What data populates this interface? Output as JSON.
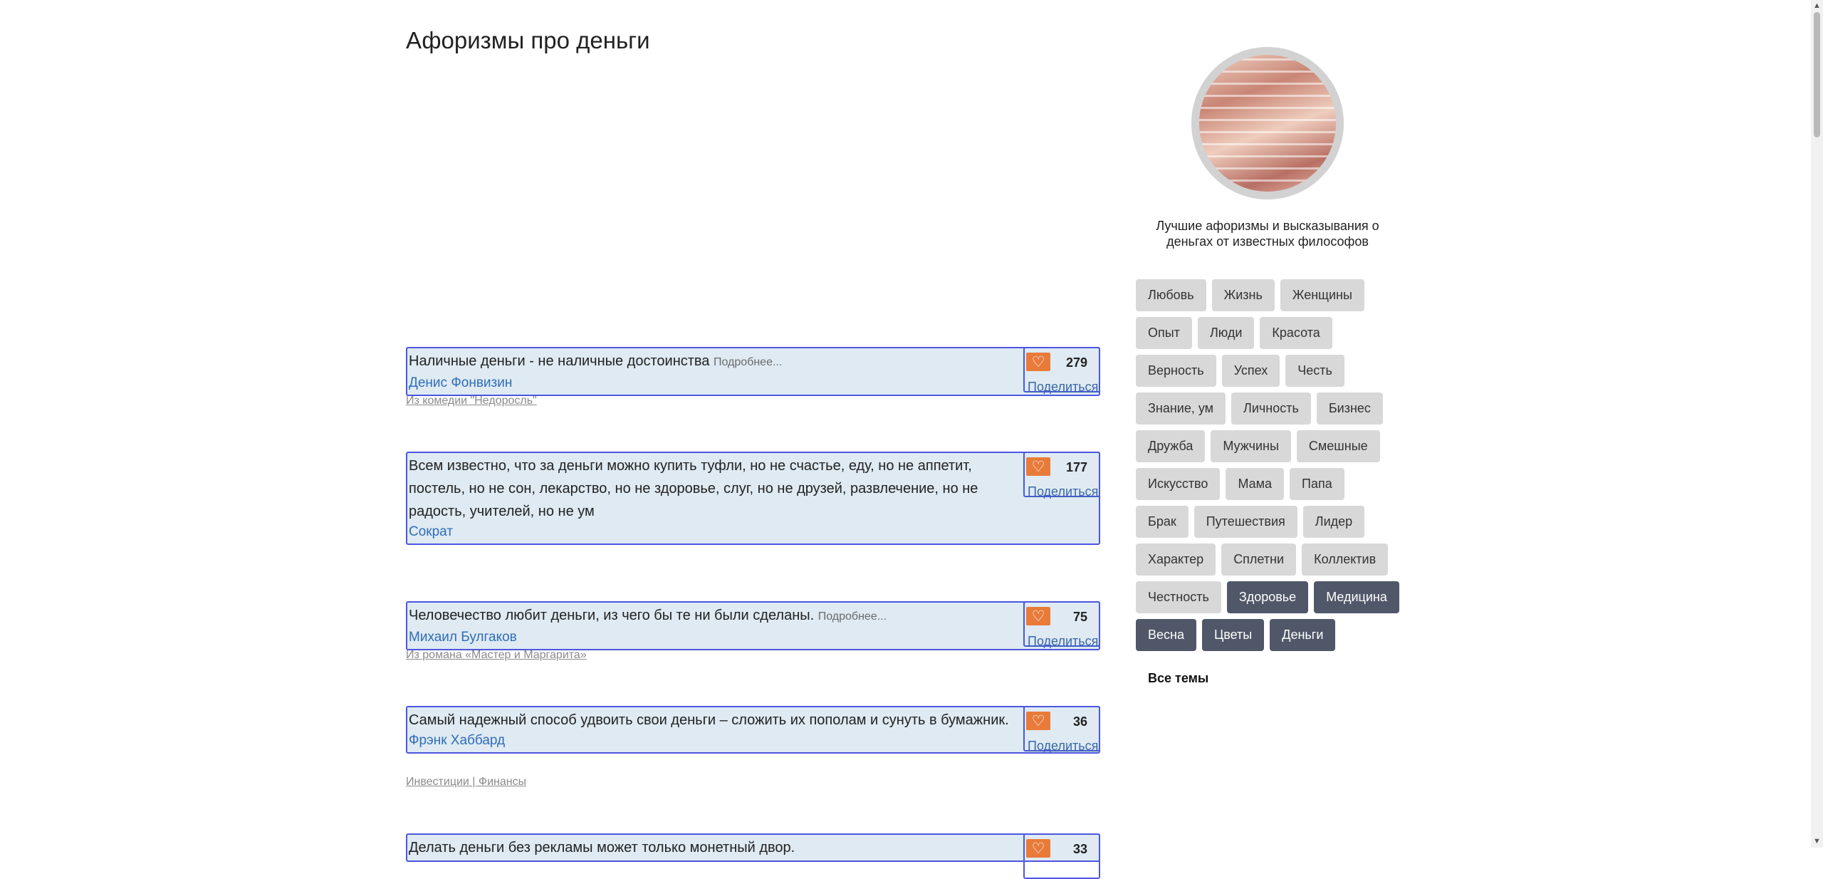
{
  "page": {
    "title": "Афоризмы про деньги"
  },
  "quotes": [
    {
      "text": "Наличные деньги - не наличные достоинства",
      "more": "Подробнее...",
      "author": "Денис Фонвизин",
      "likes": "279",
      "share": "Поделиться",
      "source": "Из комедии \"Недоросль\""
    },
    {
      "text": "Всем известно, что за деньги можно купить туфли, но не счастье, еду, но не аппетит, постель, но не сон, лекарство, но не здоровье, слуг, но не друзей, развлечение, но не радость, учителей, но не ум",
      "more": "",
      "author": "Сократ",
      "likes": "177",
      "share": "Поделиться",
      "source": ""
    },
    {
      "text": "Человечество любит деньги, из чего бы те ни были сделаны.",
      "more": "Подробнее...",
      "author": "Михаил Булгаков",
      "likes": "75",
      "share": "Поделиться",
      "source": "Из романа «Мастер и Маргарита»"
    },
    {
      "text": "Самый надежный способ удвоить свои деньги – сложить их пополам и сунуть в бумажник.",
      "more": "",
      "author": "Фрэнк Хаббард",
      "likes": "36",
      "share": "Поделиться",
      "source": "Инвестиции | Финансы"
    },
    {
      "text": "Делать деньги без рекламы может только монетный двор.",
      "more": "",
      "author": "",
      "likes": "33",
      "share": "",
      "source": ""
    }
  ],
  "sidebar": {
    "description": "Лучшие афоризмы и высказывания о деньгах от известных философов",
    "tags": [
      "Любовь",
      "Жизнь",
      "Женщины",
      "Опыт",
      "Люди",
      "Красота",
      "Верность",
      "Успех",
      "Честь",
      "Знание, ум",
      "Личность",
      "Бизнес",
      "Дружба",
      "Мужчины",
      "Смешные",
      "Искусство",
      "Мама",
      "Папа",
      "Брак",
      "Путешествия",
      "Лидер",
      "Характер",
      "Сплетни",
      "Коллектив",
      "Честность",
      "Здоровье",
      "Медицина",
      "Весна",
      "Цветы",
      "Деньги"
    ],
    "all_topics": "Все темы"
  },
  "icons": {
    "like": "heart-icon"
  },
  "colors": {
    "accent": "#e87b3a",
    "quote_bg": "#dfeaf2",
    "border": "#4c56e0",
    "link": "#2f6db8",
    "tag_dark": "#505768"
  }
}
